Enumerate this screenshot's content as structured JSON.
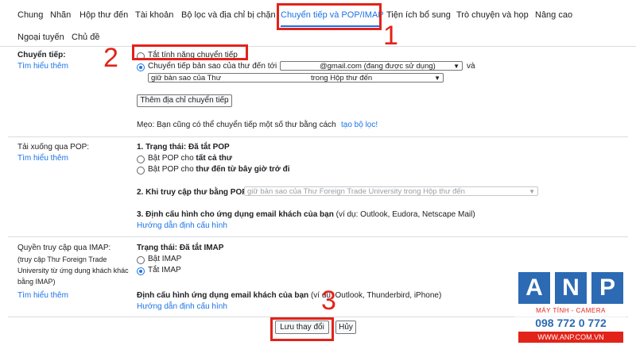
{
  "tabs": [
    {
      "label": "Chung"
    },
    {
      "label": "Nhãn"
    },
    {
      "label": "Hộp thư đến"
    },
    {
      "label": "Tài khoản"
    },
    {
      "label": "Bộ lọc và địa chỉ bị chặn"
    },
    {
      "label": "Chuyển tiếp và POP/IMAP"
    },
    {
      "label": "Tiện ích bổ sung"
    },
    {
      "label": "Trò chuyện và họp"
    },
    {
      "label": "Nâng cao"
    },
    {
      "label": "Ngoại tuyến"
    },
    {
      "label": "Chủ đề"
    }
  ],
  "forwarding": {
    "title": "Chuyển tiếp:",
    "learn_more": "Tìm hiểu thêm",
    "option_off": "Tắt tính năng chuyển tiếp",
    "option_on": "Chuyển tiếp bản sao của thư đến tới",
    "address_select": "@gmail.com (đang được sử dụng)",
    "and": "và",
    "keep_select_left": "giữ bản sao của Thư",
    "keep_select_right": "trong Hộp thư đến",
    "add_button": "Thêm địa chỉ chuyển tiếp",
    "tip_prefix": "Mẹo: Bạn cũng có thể chuyển tiếp một số thư bằng cách",
    "tip_link": "tạo bộ lọc!"
  },
  "pop": {
    "title": "Tải xuống qua POP:",
    "learn_more": "Tìm hiểu thêm",
    "status": "1. Trạng thái: Đã tắt POP",
    "opt_all_prefix": "Bật POP cho",
    "opt_all_bold": "tất cả thư",
    "opt_now_prefix": "Bật POP cho",
    "opt_now_bold": "thư đến từ bây giờ trở đi",
    "access_label": "2. Khi truy cập thư bằng POP",
    "access_select": "giữ bản sao của Thư Foreign Trade University trong Hộp thư đến",
    "config_bold": "3. Định cấu hình cho ứng dụng email khách của bạn",
    "config_rest": "(ví dụ: Outlook, Eudora, Netscape Mail)",
    "config_link": "Hướng dẫn định cấu hình"
  },
  "imap": {
    "title": "Quyền truy cập qua IMAP:",
    "sub1": "(truy cập Thư Foreign Trade",
    "sub2": "University từ ứng dụng khách khác",
    "sub3": "bằng IMAP)",
    "learn_more": "Tìm hiểu thêm",
    "status": "Trạng thái: Đã tắt IMAP",
    "opt_on": "Bật IMAP",
    "opt_off": "Tắt IMAP",
    "config_bold": "Định cấu hình ứng dụng email khách của bạn",
    "config_rest": "(ví dụ: Outlook, Thunderbird, iPhone)",
    "config_link": "Hướng dẫn định cấu hình"
  },
  "actions": {
    "save": "Lưu thay đổi",
    "cancel": "Hủy"
  },
  "annotations": {
    "n1": "1",
    "n2": "2",
    "n3": "3",
    "color": "#e2231a"
  },
  "watermark": {
    "letters": [
      "A",
      "N",
      "P"
    ],
    "line1": "MÁY TÍNH - CAMERA",
    "phone": "098 772 0 772",
    "site": "WWW.ANP.COM.VN",
    "brand_color": "#2c6ab3"
  }
}
